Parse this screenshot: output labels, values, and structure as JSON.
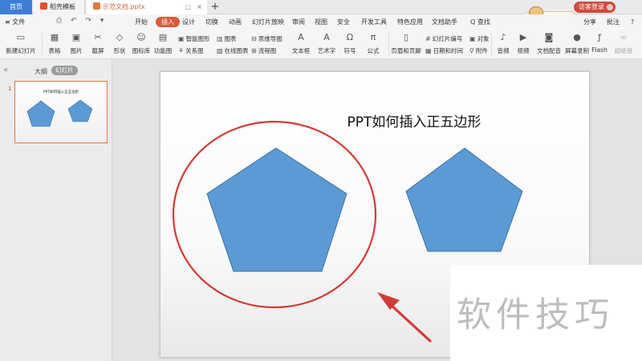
{
  "tabs": {
    "home": "首页",
    "template": "稻壳模板",
    "document": "示范文档.pptx",
    "new_tab": "+",
    "close": "×",
    "monitor": "▢"
  },
  "login": "访客登录",
  "menu": {
    "file": "≡ 文件",
    "items": [
      "开始",
      "插入",
      "设计",
      "切换",
      "动画",
      "幻灯片放映",
      "审阅",
      "视图",
      "安全",
      "开发工具",
      "特色应用",
      "文档助手"
    ],
    "active": "插入",
    "search": "Q 查找",
    "share": "分享",
    "comment": "批注",
    "help": "?"
  },
  "quick_access": "⎙ ↶ ↷ ▾",
  "ribbon": {
    "new_slide": "新建幻灯片",
    "table": "表格",
    "picture": "图片",
    "screenshot": "截屏",
    "shape": "形状",
    "icon_lib": "图标库",
    "func_chart": "功能图",
    "smart_graphic": "智能图形",
    "chart": "图表",
    "mind_map": "思维导图",
    "relation": "关系图",
    "online_chart": "在线图表",
    "flowchart": "流程图",
    "textbox": "文本框",
    "wordart": "艺术字",
    "symbol": "符号",
    "formula": "公式",
    "header_footer": "页眉和页脚",
    "slide_number": "幻灯片编号",
    "object": "对象",
    "datetime": "日期和时间",
    "attachment": "附件",
    "audio": "音频",
    "video": "视频",
    "doc_voice": "文档配音",
    "screen_record": "屏幕录制",
    "flash": "Flash",
    "hyperlink": "超链接"
  },
  "sidebar": {
    "outline": "大纲",
    "slides": "幻灯片",
    "slide_number": "1",
    "thumb_title": "PPT如何插入正五边形"
  },
  "slide": {
    "title": "PPT如何插入正五边形",
    "shape_color": "#5b9bd5",
    "annotation_color": "#d03c35"
  },
  "watermark": "软件技巧",
  "mascot": "CN"
}
